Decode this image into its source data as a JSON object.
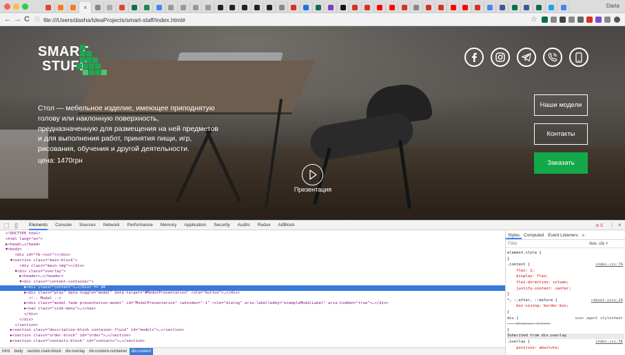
{
  "browser": {
    "active_tab_close": "×",
    "profile": "Daria",
    "url": "file:///Users/dasha/IdeaProjects/smart-staff/index.html#",
    "back": "←",
    "forward": "→",
    "reload": "C",
    "omni_icon": "ⓘ",
    "star": "☆"
  },
  "page": {
    "logo_line1": "SMART",
    "logo_line2": "STUFF",
    "description": "Стол — мебельное изделие, имеющее приподнятую голову или наклонную поверхность, предназначенную для размещения на ней предметов и для выполнения работ, принятия пищи, игр, рисования, обучения и другой деятельности.",
    "price": "цена: 1470грн",
    "play_label": "Презентация",
    "buttons": {
      "models": "Наши модели",
      "contacts": "Контакты",
      "order": "Заказать"
    },
    "social_icons": [
      "facebook-icon",
      "instagram-icon",
      "telegram-icon",
      "viber-icon",
      "phone-icon"
    ]
  },
  "devtools": {
    "tabs": [
      "Elements",
      "Console",
      "Sources",
      "Network",
      "Performance",
      "Memory",
      "Application",
      "Security",
      "Audits",
      "Redux",
      "AdBlock"
    ],
    "error_count": "⊘ 5",
    "menu": "⋮",
    "close": "×",
    "dom_lines": [
      "<!DOCTYPE html>",
      "<html lang=\"en\">",
      "▶<head>…</head>",
      "▼<body>",
      "    <div id=\"fb-root\"></div>",
      "  ▼<section class=\"main-block\">",
      "      <div class=\"main-img\"></div>",
      "    ▼<div class=\"overlay\">",
      "      ▶<header>…</header>",
      "      ▼<div class=\"content-container\">",
      "        ▶<div class=\"content\">…</div> == $0",
      "        ▶<div class=\"play\" data-toggle=\"modal\" data-target=\"#ModalPresentation\" role=\"button\">…</div>",
      "          <!-- Modal -->",
      "        ▶<div class=\"modal fade presentation-modal\" id=\"ModalPresentation\" tabindex=\"-1\" role=\"dialog\" aria-labelledby=\"exampleModalLabel\" aria-hidden=\"true\">…</div>",
      "        ▶<nav class=\"side-menu\">…</nav>",
      "        </div>",
      "      </div>",
      "    </section>",
      "  ▶<section class=\"description-block container-fluid\" id=\"models\">…</section>",
      "  ▶<section class=\"order-block\" id=\"order\">…</section>",
      "  ▶<section class=\"contacts-block\" id=\"contacts\">…</section>"
    ],
    "dom_selected_index": 10,
    "breadcrumbs": [
      "html",
      "body",
      "section.main-block",
      "div.overlay",
      "div.content-container",
      "div.content"
    ],
    "styles_tabs": [
      "Styles",
      "Computed",
      "Event Listeners",
      "»"
    ],
    "filter_placeholder": "Filter",
    "filter_hov": ":hov  .cls  +",
    "styles_lines": [
      {
        "text": "element.style {",
        "src": ""
      },
      {
        "text": "}",
        "src": ""
      },
      {
        "text": ".content {",
        "src": "index.css:74"
      },
      {
        "text": "    flex: 1;",
        "src": ""
      },
      {
        "text": "    display: flex;",
        "src": ""
      },
      {
        "text": "    flex-direction: column;",
        "src": ""
      },
      {
        "text": "    justify-content: center;",
        "src": ""
      },
      {
        "text": "}",
        "src": ""
      },
      {
        "text": "*, ::after, ::before {",
        "src": "reboot.scss:24"
      },
      {
        "text": "    box-sizing: border-box;",
        "src": ""
      },
      {
        "text": "}",
        "src": ""
      },
      {
        "text": "div {",
        "src": "user agent stylesheet"
      },
      {
        "text": "    display: block;",
        "src": ""
      },
      {
        "text": "}",
        "src": ""
      },
      {
        "text": "Inherited from div.overlay",
        "src": ""
      },
      {
        "text": ".overlay {",
        "src": "index.css:36"
      },
      {
        "text": "    position: absolute;",
        "src": ""
      }
    ]
  }
}
